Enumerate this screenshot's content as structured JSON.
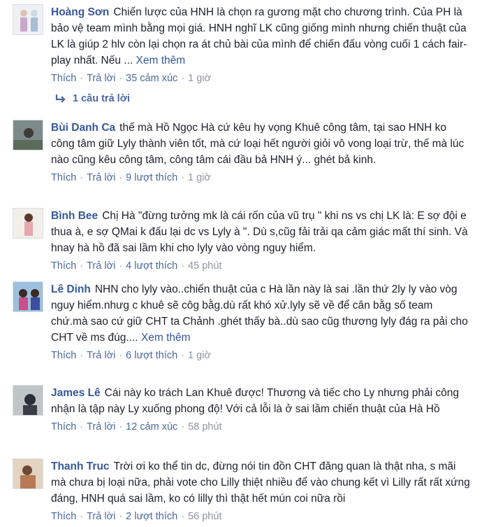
{
  "labels": {
    "like": "Thích",
    "reply": "Trả lời",
    "sep": "·",
    "see_more": "Xem thêm",
    "ellipsis": "..."
  },
  "comments": [
    {
      "name": "Hoàng Sơn",
      "text": "Chiến lược của HNH là chọn ra gương mặt cho chương trình. Của PH là bảo vệ team mình bằng mọi giá. HNH nghĩ LK cũng giống mình nhưng chiến thuật của LK là giúp 2 hlv còn lại chọn ra át chủ bài của mình để chiến đấu vòng cuối 1 cách fair-play nhất. Nếu",
      "reactions": "35 cảm xúc",
      "time": "1 giờ",
      "replies": "1 câu trả lời"
    },
    {
      "name": "Bùi Danh Ca",
      "text": "thế mà Hồ Ngọc Hà cứ kêu hy vọng Khuê công tâm, tại sao HNH ko công tâm giữ Lyly thành viên tốt, mà cứ loại hết người giỏi vô vong loại trừ, thế mà lúc nào cũng kêu công tâm, công tâm cái đầu bả HNH ý... ghét bả kinh.",
      "reactions": "9 lượt thích",
      "time": "1 giờ"
    },
    {
      "name": "Bình Bee",
      "text": "Chị Hà \"đừng tưởng mk là cái rốn của vũ trụ \" khi ns vs chị LK là: E sợ đội e thua à, e sợ QMai k đấu lại dc vs Lyly à \". Dù s,cũg fải trải qa cảm giác mất thí sinh. Và hnay hà hồ đã sai lầm khi cho lyly vào vòng nguy hiểm.",
      "reactions": "4 lượt thích",
      "time": "45 phút"
    },
    {
      "name": "Lê Dinh",
      "text": "NHN cho lyly vào..chiến thuật của c Hà lần này là sai .lần thứ 2ly ly vào vòg nguy hiểm.nhưg c khuê sẽ côg bằg.dù rất khó xử.lyly sẽ về để cân bằg số team chứ.mà sao cứ giữ CHT ta Chảnh .ghét thấy bà..dù sao cũg thương lyly đág ra pải cho CHT về ms đúg....",
      "reactions": "6 lượt thích",
      "time": "1 giờ"
    },
    {
      "name": "James Lê",
      "text": "Cái này ko trách Lan Khuê được! Thương và tiếc cho Ly nhưng phải công nhận là tập này Ly xuống phong độ! Với cả lỗi là ở sai lầm chiến thuật của Hà Hồ",
      "reactions": "12 cảm xúc",
      "time": "58 phút"
    },
    {
      "name": "Thanh Truc",
      "text": "Trời ơi ko thể tin dc, đừng nói tin đồn CHT đăng quan là thật nha, s mãi mà chưa bị loại nữa, phải vote cho Lilly thiệt nhiều để vào chung kết vì Lilly rất rất xứng đáng, HNH quá sai lầm, ko có lilly thì thật hết mún coi nữa rồi",
      "reactions": "2 lượt thích",
      "time": "56 phút"
    }
  ]
}
